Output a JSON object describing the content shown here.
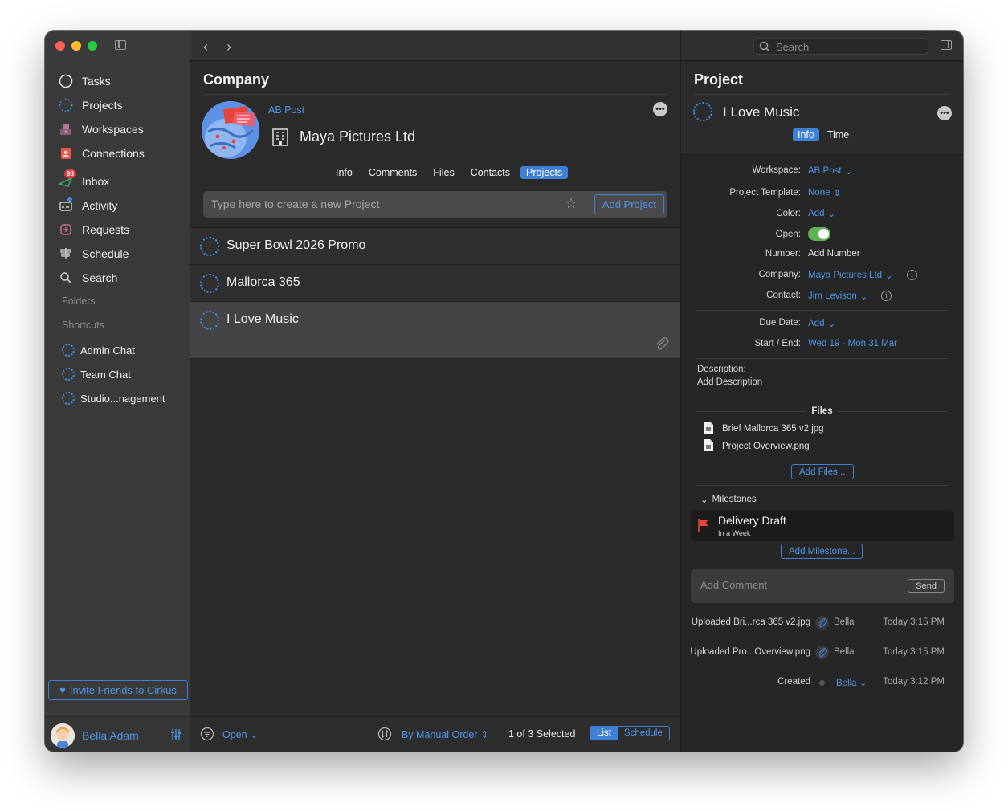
{
  "sidebar": {
    "nav": [
      {
        "label": "Tasks",
        "icon": "circle-icon"
      },
      {
        "label": "Projects",
        "icon": "dotted-circle-icon"
      },
      {
        "label": "Workspaces",
        "icon": "workspaces-icon"
      },
      {
        "label": "Connections",
        "icon": "connections-icon"
      },
      {
        "label": "Inbox",
        "icon": "inbox-icon",
        "badge": "98"
      },
      {
        "label": "Activity",
        "icon": "activity-icon"
      },
      {
        "label": "Requests",
        "icon": "requests-icon"
      },
      {
        "label": "Schedule",
        "icon": "schedule-icon"
      },
      {
        "label": "Search",
        "icon": "search-icon"
      }
    ],
    "folders_label": "Folders",
    "shortcuts_label": "Shortcuts",
    "shortcuts": [
      "Admin Chat",
      "Team Chat",
      "Studio...nagement"
    ],
    "invite_label": "Invite Friends to Cirkus",
    "user_name": "Bella Adam"
  },
  "middle": {
    "title": "Company",
    "workspace_link": "AB Post",
    "company_name": "Maya Pictures Ltd",
    "tabs": [
      "Info",
      "Comments",
      "Files",
      "Contacts",
      "Projects"
    ],
    "active_tab": "Projects",
    "new_project_placeholder": "Type here to create a new Project",
    "add_project_label": "Add Project",
    "projects": [
      "Super Bowl 2026 Promo",
      "Mallorca 365",
      "I Love Music"
    ],
    "footer": {
      "filter": "Open",
      "sort": "By Manual Order",
      "selection": "1 of 3 Selected",
      "view_list": "List",
      "view_schedule": "Schedule"
    }
  },
  "right": {
    "search_placeholder": "Search",
    "title": "Project",
    "project_name": "I Love Music",
    "tabs": [
      "Info",
      "Time"
    ],
    "fields": {
      "workspace_label": "Workspace:",
      "workspace_value": "AB Post",
      "template_label": "Project Template:",
      "template_value": "None",
      "color_label": "Color:",
      "color_value": "Add",
      "open_label": "Open:",
      "number_label": "Number:",
      "number_value": "Add Number",
      "company_label": "Company:",
      "company_value": "Maya Pictures Ltd",
      "contact_label": "Contact:",
      "contact_value": "Jim Levison",
      "due_label": "Due Date:",
      "due_value": "Add",
      "startend_label": "Start / End:",
      "startend_value": "Wed 19 - Mon 31 Mar"
    },
    "description_label": "Description:",
    "description_value": "Add Description",
    "files_label": "Files",
    "files": [
      "Brief Mallorca 365 v2.jpg",
      "Project Overview.png"
    ],
    "add_files_label": "Add Files...",
    "milestones_label": "Milestones",
    "milestone": {
      "title": "Delivery Draft",
      "due": "In a Week"
    },
    "add_milestone_label": "Add Milestone...",
    "comment_placeholder": "Add Comment",
    "send_label": "Send",
    "timeline": [
      {
        "action": "Uploaded Bri...rca 365 v2.jpg",
        "who": "Bella",
        "time": "Today 3:15 PM"
      },
      {
        "action": "Uploaded Pro...Overview.png",
        "who": "Bella",
        "time": "Today 3:15 PM"
      },
      {
        "action": "Created",
        "who": "Bella",
        "time": "Today 3:12 PM"
      }
    ]
  },
  "colors": {
    "accent": "#3e80d6",
    "link": "#4f95e6",
    "toggle_on": "#5fb354",
    "badge": "#e0393e",
    "flag": "#e8463b"
  }
}
